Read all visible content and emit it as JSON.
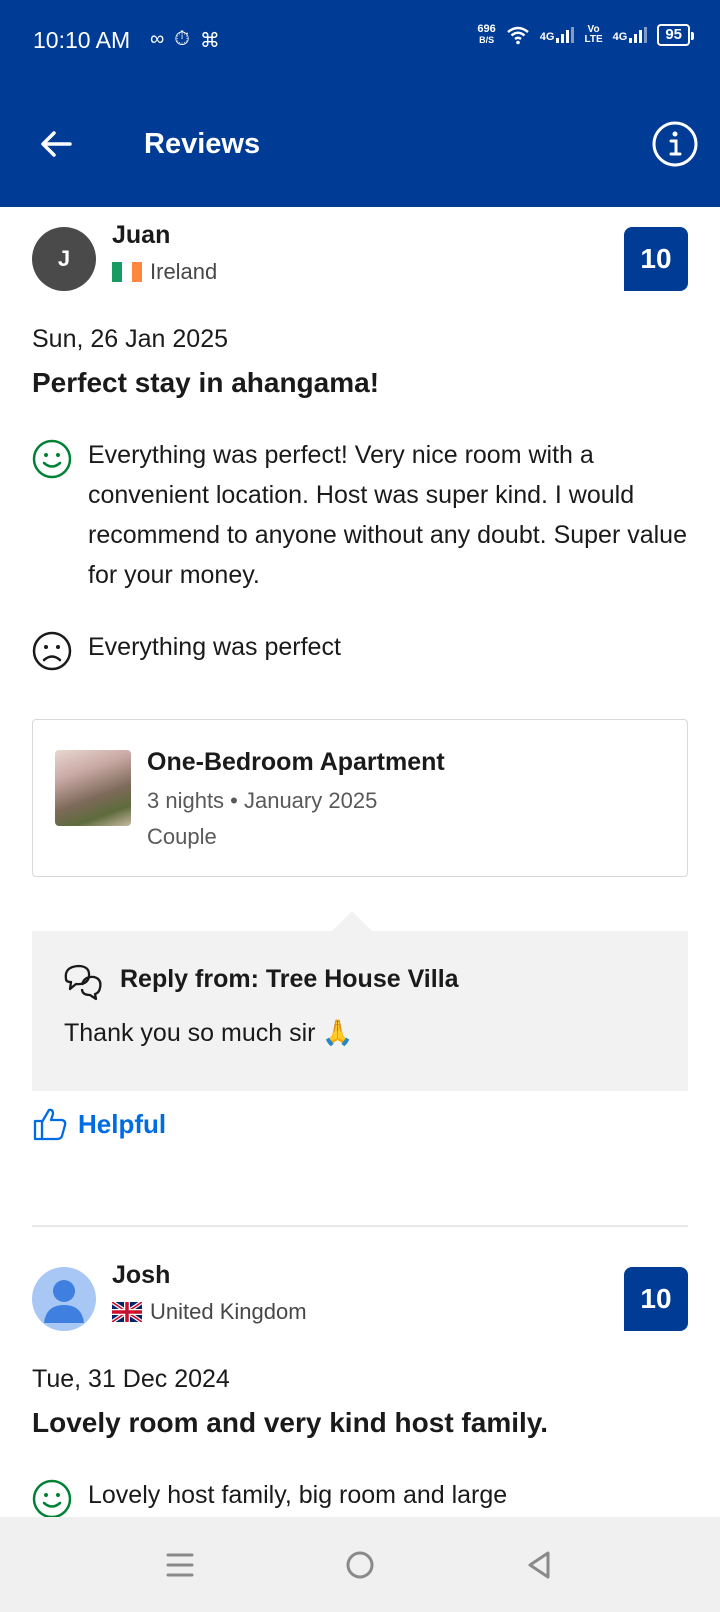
{
  "status_bar": {
    "time": "10:10 AM",
    "speed_value": "696",
    "speed_unit": "B/S",
    "net1": "4G",
    "volte_top": "Vo",
    "volte_bottom": "LTE",
    "net2": "4G",
    "battery": "95"
  },
  "header": {
    "title": "Reviews"
  },
  "reviews": [
    {
      "initial": "J",
      "name": "Juan",
      "country": "Ireland",
      "score": "10",
      "date": "Sun, 26 Jan 2025",
      "title": "Perfect stay in ahangama!",
      "positive": "Everything was perfect! Very nice room with a convenient location. Host was super kind. I would recommend to anyone without any doubt. Super value for your money.",
      "negative": "Everything was perfect",
      "room": {
        "name": "One-Bedroom Apartment",
        "meta": "3 nights • January 2025",
        "type": "Couple"
      },
      "reply": {
        "heading": "Reply from: Tree House Villa",
        "text": "Thank you so much sir 🙏"
      },
      "helpful_label": "Helpful"
    },
    {
      "name": "Josh",
      "country": "United Kingdom",
      "score": "10",
      "date": "Tue, 31 Dec 2024",
      "title": "Lovely room and very kind host family.",
      "positive": "Lovely host family, big room and large"
    }
  ],
  "icons": {
    "back": "arrow-left-icon",
    "info": "info-icon",
    "positive": "smile-icon",
    "negative": "frown-icon",
    "reply": "chat-bubbles-icon",
    "helpful": "thumbs-up-icon"
  },
  "colors": {
    "brand": "#003b95",
    "link": "#006ce4",
    "positive_icon": "#008234"
  }
}
